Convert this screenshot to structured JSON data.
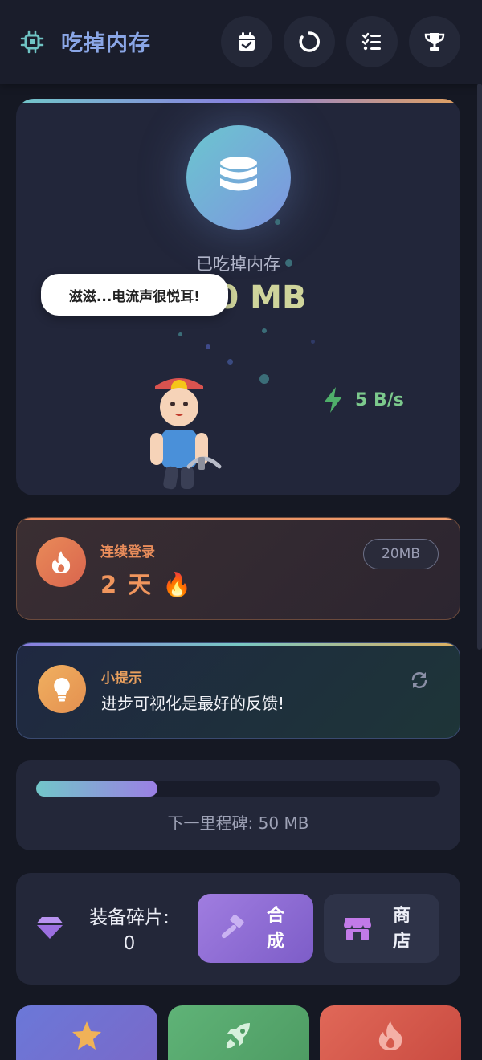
{
  "app": {
    "title": "吃掉内存"
  },
  "header": {
    "buttons": [
      {
        "name": "calendar-check-icon"
      },
      {
        "name": "loading-ring-icon"
      },
      {
        "name": "task-list-icon"
      },
      {
        "name": "trophy-icon"
      }
    ]
  },
  "main": {
    "eaten_label": "已吃掉内存",
    "eaten_value_visible": "00 MB",
    "speech": "滋滋...电流声很悦耳!",
    "speed": "5 B/s"
  },
  "streak": {
    "label": "连续登录",
    "value": "2 天 🔥",
    "reward": "20MB"
  },
  "tip": {
    "label": "小提示",
    "text": "进步可视化是最好的反馈!"
  },
  "milestone": {
    "progress_fraction": 0.3,
    "text": "下一里程碑: 50 MB"
  },
  "equipment": {
    "label": "装备碎片:",
    "count": "0",
    "craft_label": "合成",
    "shop_label": "商店"
  },
  "tiles": [
    {
      "name": "star-icon"
    },
    {
      "name": "rocket-icon"
    },
    {
      "name": "fire-icon"
    }
  ],
  "colors": {
    "background": "#151823",
    "card": "#22263a",
    "accent_purple": "#9b7fe4",
    "accent_teal": "#72c6c9",
    "accent_orange": "#e98d5b",
    "success_green": "#7cc98c"
  }
}
